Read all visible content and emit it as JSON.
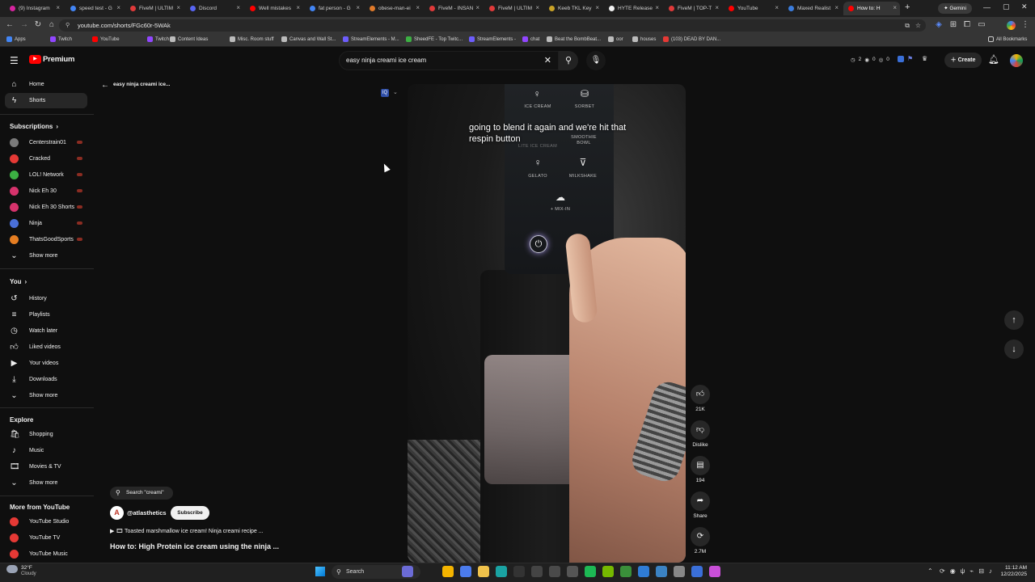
{
  "browser": {
    "tabs": [
      {
        "title": "(9) Instagram",
        "color": "#d6249f"
      },
      {
        "title": "speed test - G",
        "color": "#4285f4"
      },
      {
        "title": "FiveM | ULTIM",
        "color": "#e03a3a"
      },
      {
        "title": "Discord",
        "color": "#5865f2"
      },
      {
        "title": "Well mistakes",
        "color": "#ff0000"
      },
      {
        "title": "fat person - G",
        "color": "#4285f4"
      },
      {
        "title": "obese-man-ei",
        "color": "#e07a2a"
      },
      {
        "title": "FiveM - INSAN",
        "color": "#e03a3a"
      },
      {
        "title": "FiveM | ULTIM",
        "color": "#e03a3a"
      },
      {
        "title": "Keeb TKL Key",
        "color": "#c9a227"
      },
      {
        "title": "HYTE Release",
        "color": "#f0f0f0"
      },
      {
        "title": "FiveM | TOP-T",
        "color": "#e03a3a"
      },
      {
        "title": "YouTube",
        "color": "#ff0000"
      },
      {
        "title": "Maxed Realist",
        "color": "#3b7ddd"
      },
      {
        "title": "How to: H",
        "color": "#ff0000"
      }
    ],
    "gemini_label": "Gemini",
    "url": "youtube.com/shorts/FGc60r-5WAk",
    "bookmarks": [
      "Apps",
      "Twitch",
      "YouTube",
      "Twitch",
      "Content Ideas",
      "Misc. Room stuff",
      "Canvas and Wall St...",
      "StreamElements - M...",
      "SheedFE - Top Twitc...",
      "StreamElements -",
      "chat",
      "Beat the BombBeat...",
      "oor",
      "houses",
      "(103) DEAD BY DAN..."
    ],
    "all_bookmarks": "All Bookmarks"
  },
  "youtube": {
    "logo_text": "Premium",
    "search_value": "easy ninja creami ice cream",
    "create_label": "Create",
    "ext_counts": [
      "2",
      "0",
      "0"
    ],
    "back_title": "easy ninja creami ice...",
    "sidebar": {
      "main": [
        {
          "label": "Home",
          "icon": "home-icon"
        },
        {
          "label": "Shorts",
          "icon": "shorts-icon"
        }
      ],
      "subscriptions_heading": "Subscriptions",
      "channels": [
        {
          "label": "Centerstrain01",
          "color": "#7a7a7a"
        },
        {
          "label": "Cracked",
          "color": "#e53935"
        },
        {
          "label": "LOL! Network",
          "color": "#3cb043"
        },
        {
          "label": "Nick Eh 30",
          "color": "#d6336c"
        },
        {
          "label": "Nick Eh 30 Shorts",
          "color": "#d6336c"
        },
        {
          "label": "Ninja",
          "color": "#4a6fd8"
        },
        {
          "label": "ThatsGoodSports",
          "color": "#e67e22"
        }
      ],
      "show_more": "Show more",
      "you_heading": "You",
      "you_items": [
        {
          "label": "History",
          "icon": "history-icon"
        },
        {
          "label": "Playlists",
          "icon": "playlists-icon"
        },
        {
          "label": "Watch later",
          "icon": "watch-later-icon"
        },
        {
          "label": "Liked videos",
          "icon": "liked-videos-icon"
        },
        {
          "label": "Your videos",
          "icon": "your-videos-icon"
        },
        {
          "label": "Downloads",
          "icon": "downloads-icon"
        }
      ],
      "explore_heading": "Explore",
      "explore_items": [
        {
          "label": "Shopping",
          "icon": "shopping-icon"
        },
        {
          "label": "Music",
          "icon": "music-icon"
        },
        {
          "label": "Movies & TV",
          "icon": "movies-icon"
        }
      ],
      "more_heading": "More from YouTube",
      "more_items": [
        "YouTube Studio",
        "YouTube TV",
        "YouTube Music"
      ]
    },
    "short": {
      "caption": "going to blend it again and we're hit that respin button",
      "appliance_labels": [
        "ICE CREAM",
        "SORBET",
        "LITE ICE CREAM",
        "SMOOTHIE BOWL",
        "GELATO",
        "MILKSHAKE",
        "+ MIX-IN"
      ],
      "search_chip": "Search \"creami\"",
      "channel": "@atlasthetics",
      "subscribe": "Subscribe",
      "playlist_line": "▶ 🎞 Toasted marshmallow ice cream! Ninja creami recipe ...",
      "title": "How to: High Protein ice cream using the ninja ...",
      "likes": "21K",
      "dislike": "Dislike",
      "comments": "194",
      "share": "Share",
      "remix": "2.7M"
    }
  },
  "taskbar": {
    "temp": "32°F",
    "weather": "Cloudy",
    "search": "Search",
    "time": "11:12 AM",
    "date": "12/22/2025"
  }
}
